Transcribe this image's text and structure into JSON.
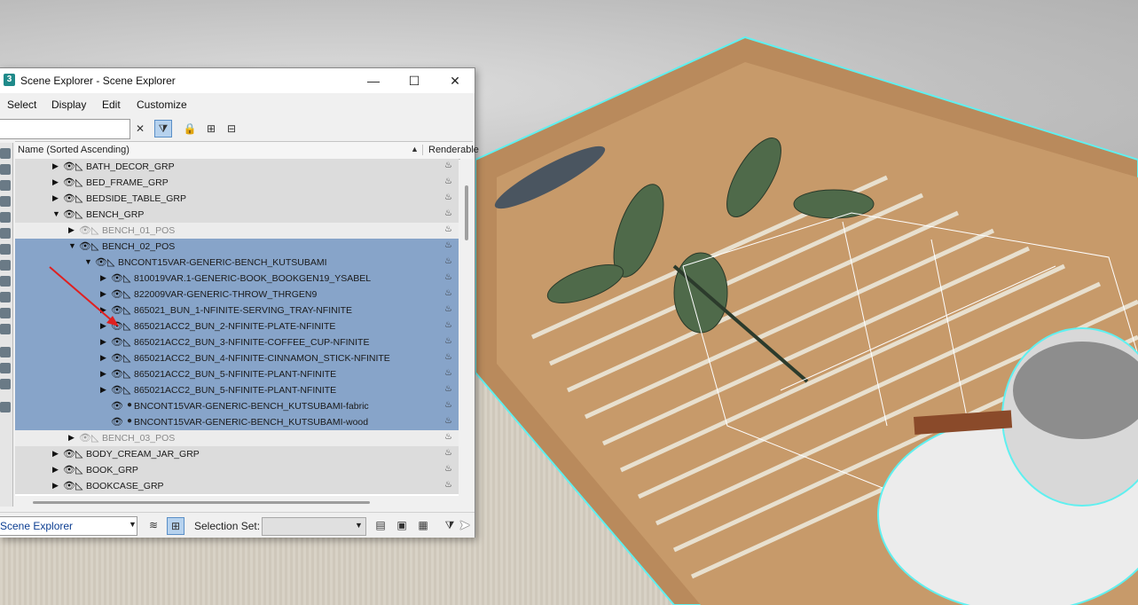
{
  "window": {
    "title": "Scene Explorer - Scene Explorer",
    "app_icon": "3",
    "controls": {
      "minimize": "—",
      "maximize": "☐",
      "close": "✕"
    }
  },
  "menu": [
    "Select",
    "Display",
    "Edit",
    "Customize"
  ],
  "toolbar": {
    "search_value": "",
    "clear_glyph": "✕"
  },
  "columns": {
    "name": "Name (Sorted Ascending)",
    "renderable": "Renderable",
    "sort_glyph": "▲"
  },
  "tree": [
    {
      "label": "BATH_DECOR_GRP",
      "exp": "▶",
      "style": "grp",
      "sel": false
    },
    {
      "label": "BED_FRAME_GRP",
      "exp": "▶",
      "style": "grp",
      "sel": false
    },
    {
      "label": "BEDSIDE_TABLE_GRP",
      "exp": "▶",
      "style": "grp",
      "sel": false
    },
    {
      "label": "BENCH_GRP",
      "exp": "▼",
      "style": "grp",
      "sel": false
    },
    {
      "label": "BENCH_01_POS",
      "exp": "▶",
      "style": "plain",
      "sel": false
    },
    {
      "label": "BENCH_02_POS",
      "exp": "▼",
      "style": "sel",
      "sel": true
    },
    {
      "label": "BNCONT15VAR-GENERIC-BENCH_KUTSUBAMI",
      "exp": "▼",
      "style": "sel",
      "sel": true
    },
    {
      "label": "810019VAR.1-GENERIC-BOOK_BOOKGEN19_YSABEL",
      "exp": "▶",
      "style": "sel",
      "sel": true
    },
    {
      "label": "822009VAR-GENERIC-THROW_THRGEN9",
      "exp": "▶",
      "style": "sel",
      "sel": true
    },
    {
      "label": "865021_BUN_1-NFINITE-SERVING_TRAY-NFINITE",
      "exp": "▶",
      "style": "sel",
      "sel": true
    },
    {
      "label": "865021ACC2_BUN_2-NFINITE-PLATE-NFINITE",
      "exp": "▶",
      "style": "sel",
      "sel": true
    },
    {
      "label": "865021ACC2_BUN_3-NFINITE-COFFEE_CUP-NFINITE",
      "exp": "▶",
      "style": "sel",
      "sel": true
    },
    {
      "label": "865021ACC2_BUN_4-NFINITE-CINNAMON_STICK-NFINITE",
      "exp": "▶",
      "style": "sel",
      "sel": true
    },
    {
      "label": "865021ACC2_BUN_5-NFINITE-PLANT-NFINITE",
      "exp": "▶",
      "style": "sel",
      "sel": true
    },
    {
      "label": "865021ACC2_BUN_5-NFINITE-PLANT-NFINITE",
      "exp": "▶",
      "style": "sel",
      "sel": true
    },
    {
      "label": "BNCONT15VAR-GENERIC-BENCH_KUTSUBAMI-fabric",
      "exp": "",
      "style": "sel",
      "sel": true
    },
    {
      "label": "BNCONT15VAR-GENERIC-BENCH_KUTSUBAMI-wood",
      "exp": "",
      "style": "sel",
      "sel": true
    },
    {
      "label": "BENCH_03_POS",
      "exp": "▶",
      "style": "plain",
      "sel": false
    },
    {
      "label": "BODY_CREAM_JAR_GRP",
      "exp": "▶",
      "style": "grp",
      "sel": false
    },
    {
      "label": "BOOK_GRP",
      "exp": "▶",
      "style": "grp",
      "sel": false
    },
    {
      "label": "BOOKCASE_GRP",
      "exp": "▶",
      "style": "grp",
      "sel": false
    }
  ],
  "statusbar": {
    "explorer_name": "Scene Explorer",
    "selection_set_label": "Selection Set:",
    "selection_set_value": ""
  },
  "glyphs": {
    "eye": "👁",
    "layer": "◺",
    "teapot": "♨",
    "dot": "●"
  }
}
